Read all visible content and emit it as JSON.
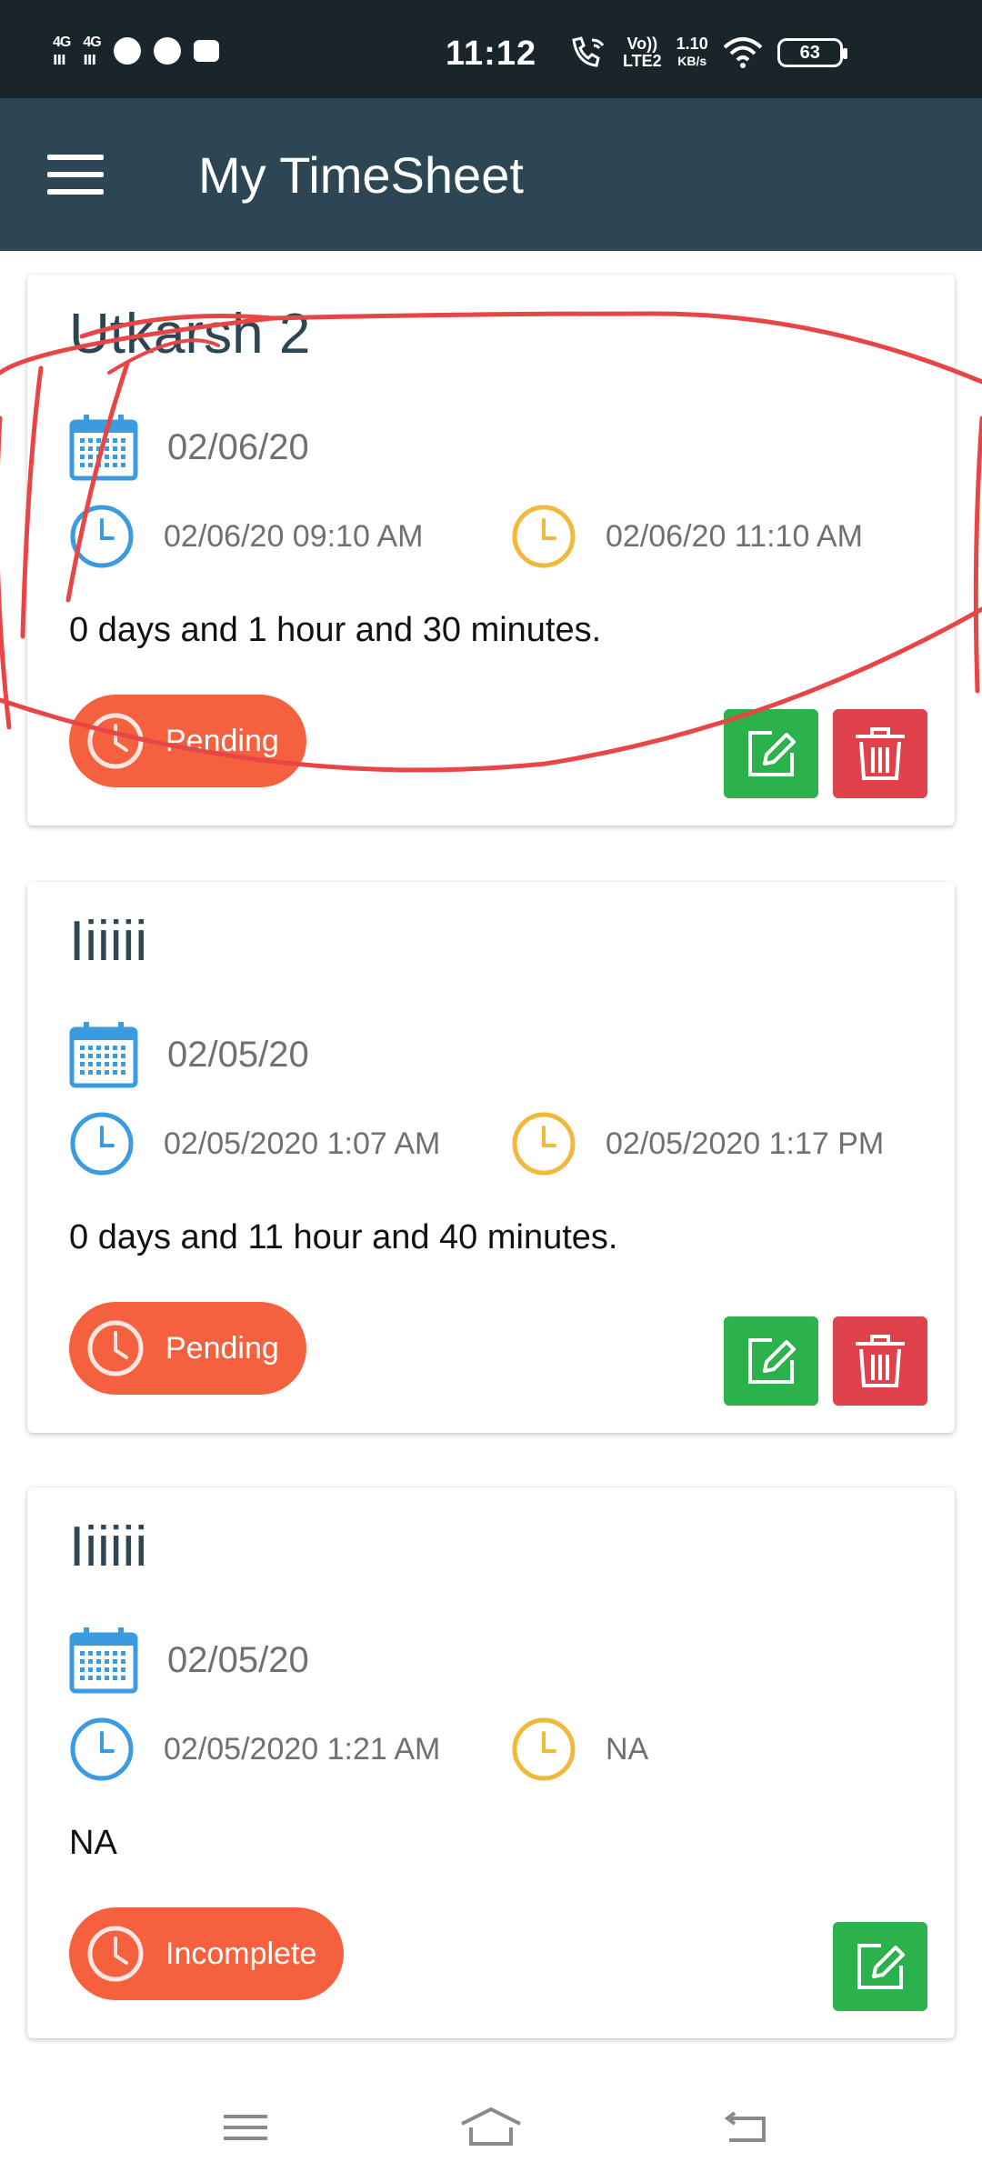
{
  "status_bar": {
    "network1": "4G",
    "network2": "4G",
    "time": "11:12",
    "volte": "Vo))",
    "lte": "LTE2",
    "speed_value": "1.10",
    "speed_unit": "KB/s",
    "battery": "63"
  },
  "app_bar": {
    "title": "My TimeSheet",
    "menu_icon": "hamburger-menu-icon"
  },
  "entries": [
    {
      "title": "Utkarsh 2",
      "date": "02/06/20",
      "start": "02/06/20 09:10 AM",
      "end": "02/06/20 11:10 AM",
      "duration": "0 days and 1 hour and 30 minutes.",
      "status": "Pending",
      "can_delete": true
    },
    {
      "title": "Iiiiii",
      "date": "02/05/20",
      "start": "02/05/2020 1:07 AM",
      "end": "02/05/2020 1:17 PM",
      "duration": "0 days and 11 hour and 40 minutes.",
      "status": "Pending",
      "can_delete": true
    },
    {
      "title": "Iiiiii",
      "date": "02/05/20",
      "start": "02/05/2020 1:21 AM",
      "end": "NA",
      "duration": "NA",
      "status": "Incomplete",
      "can_delete": false
    }
  ],
  "colors": {
    "status_bar": "#1a252b",
    "app_bar": "#2c4654",
    "title_text": "#2c4654",
    "calendar_icon": "#3b9be0",
    "start_clock": "#3b9be0",
    "end_clock": "#f0b93a",
    "status_pill": "#f5613f",
    "edit_button": "#2bb24c",
    "delete_button": "#e0424b",
    "annotation_scribble": "#e84646"
  },
  "icons": {
    "calendar": "calendar-icon",
    "start_time": "clock-icon",
    "end_time": "clock-icon",
    "status": "clock-icon",
    "edit": "edit-icon",
    "delete": "trash-icon"
  },
  "nav_bar": {
    "buttons": [
      "menu-icon",
      "home-icon",
      "back-icon"
    ]
  }
}
